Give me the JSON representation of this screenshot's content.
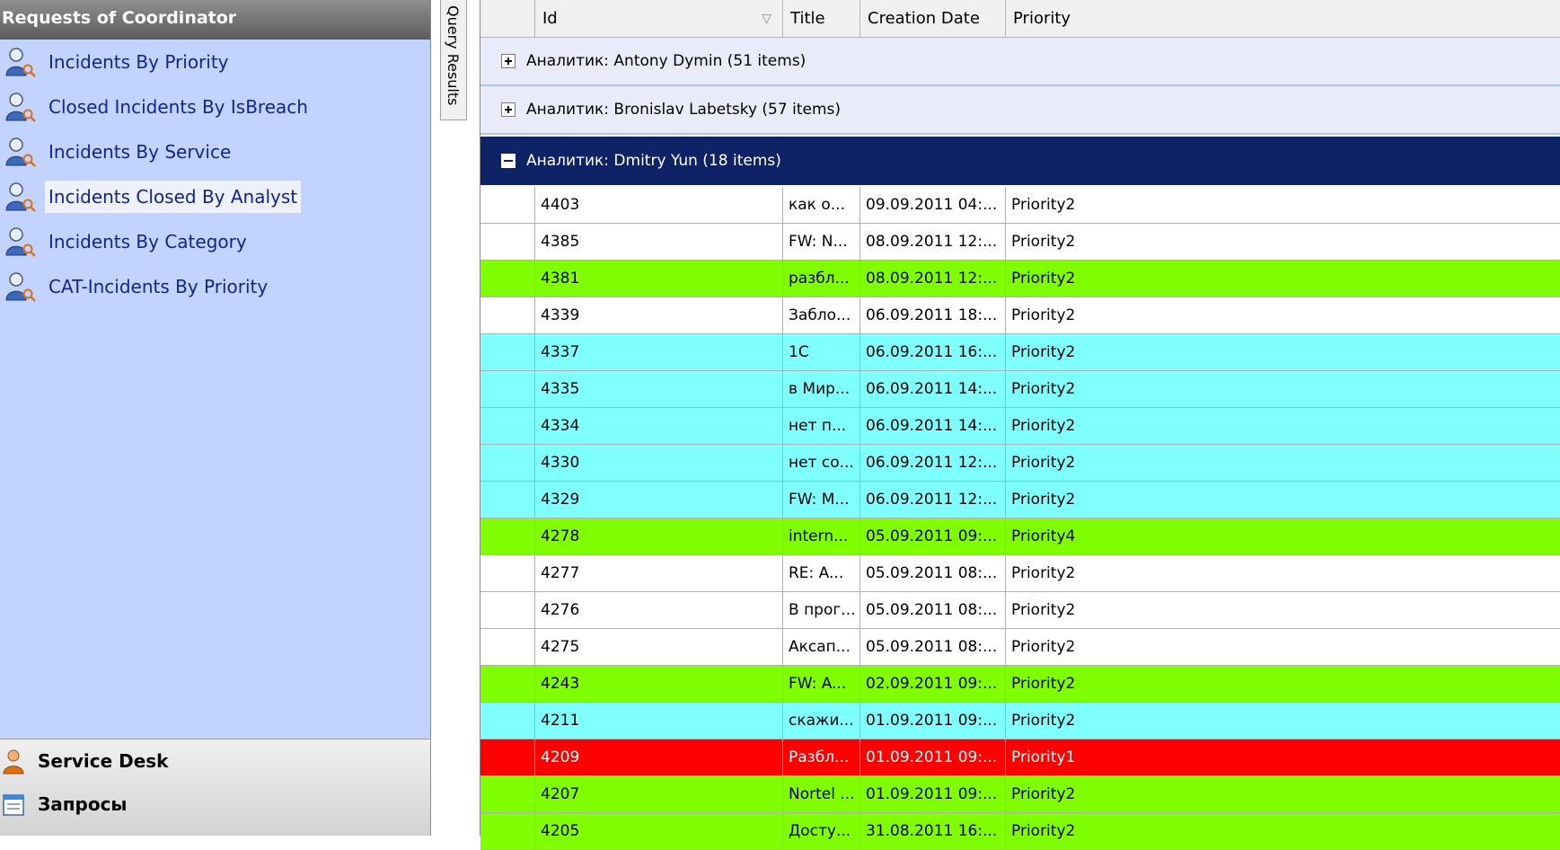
{
  "left_panel": {
    "title": "Requests of Coordinator",
    "items": [
      {
        "label": "Incidents By Priority",
        "selected": false
      },
      {
        "label": "Closed Incidents By IsBreach",
        "selected": false
      },
      {
        "label": "Incidents By Service",
        "selected": false
      },
      {
        "label": "Incidents Closed By Analyst",
        "selected": true
      },
      {
        "label": "Incidents By Category",
        "selected": false
      },
      {
        "label": "CAT-Incidents By Priority",
        "selected": false
      }
    ],
    "bottom_items": [
      {
        "label": "Service Desk",
        "icon": "user-icon"
      },
      {
        "label": "Запросы",
        "icon": "requests-icon"
      }
    ]
  },
  "side_tab": {
    "label": "Query Results"
  },
  "grid": {
    "columns": [
      "Id",
      "Title",
      "Creation Date",
      "Priority"
    ],
    "sort_indicator": "▽",
    "groups": [
      {
        "label": "Аналитик: Antony Dymin (51 items)",
        "expanded": false
      },
      {
        "label": "Аналитик: Bronislav Labetsky (57 items)",
        "expanded": false
      },
      {
        "label": "Аналитик: Dmitry Yun (18 items)",
        "expanded": true
      }
    ],
    "rows": [
      {
        "id": "4403",
        "title": "как о...",
        "date": "09.09.2011 04:...",
        "priority": "Priority2",
        "color": "white"
      },
      {
        "id": "4385",
        "title": "FW: N...",
        "date": "08.09.2011 12:...",
        "priority": "Priority2",
        "color": "white"
      },
      {
        "id": "4381",
        "title": "разбл...",
        "date": "08.09.2011 12:...",
        "priority": "Priority2",
        "color": "green"
      },
      {
        "id": "4339",
        "title": "Забло...",
        "date": "06.09.2011 18:...",
        "priority": "Priority2",
        "color": "white"
      },
      {
        "id": "4337",
        "title": "1С",
        "date": "06.09.2011 16:...",
        "priority": "Priority2",
        "color": "cyan"
      },
      {
        "id": "4335",
        "title": "в Мир...",
        "date": "06.09.2011 14:...",
        "priority": "Priority2",
        "color": "cyan"
      },
      {
        "id": "4334",
        "title": "нет п...",
        "date": "06.09.2011 14:...",
        "priority": "Priority2",
        "color": "cyan"
      },
      {
        "id": "4330",
        "title": "нет со...",
        "date": "06.09.2011 12:...",
        "priority": "Priority2",
        "color": "cyan"
      },
      {
        "id": "4329",
        "title": "FW: M...",
        "date": "06.09.2011 12:...",
        "priority": "Priority2",
        "color": "cyan"
      },
      {
        "id": "4278",
        "title": "intern...",
        "date": "05.09.2011 09:...",
        "priority": "Priority4",
        "color": "green"
      },
      {
        "id": "4277",
        "title": "RE: A...",
        "date": "05.09.2011 08:...",
        "priority": "Priority2",
        "color": "white"
      },
      {
        "id": "4276",
        "title": "В прог...",
        "date": "05.09.2011 08:...",
        "priority": "Priority2",
        "color": "white"
      },
      {
        "id": "4275",
        "title": "Аксап...",
        "date": "05.09.2011 08:...",
        "priority": "Priority2",
        "color": "white"
      },
      {
        "id": "4243",
        "title": "FW: A...",
        "date": "02.09.2011 09:...",
        "priority": "Priority2",
        "color": "green"
      },
      {
        "id": "4211",
        "title": "скажи...",
        "date": "01.09.2011 09:...",
        "priority": "Priority2",
        "color": "cyan"
      },
      {
        "id": "4209",
        "title": "Разбл...",
        "date": "01.09.2011 09:...",
        "priority": "Priority1",
        "color": "red"
      },
      {
        "id": "4207",
        "title": "Nortel ...",
        "date": "01.09.2011 09:...",
        "priority": "Priority2",
        "color": "green"
      },
      {
        "id": "4205",
        "title": "Досту...",
        "date": "31.08.2011 16:...",
        "priority": "Priority2",
        "color": "green"
      }
    ]
  }
}
